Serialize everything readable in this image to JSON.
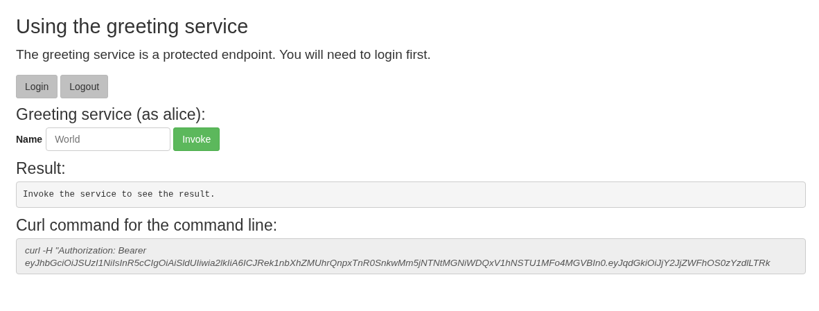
{
  "heading": "Using the greeting service",
  "intro": "The greeting service is a protected endpoint. You will need to login first.",
  "auth_buttons": [
    "Login",
    "Logout"
  ],
  "greeting": {
    "heading": "Greeting service (as alice):",
    "label": "Name",
    "placeholder": "World",
    "button": "Invoke"
  },
  "result": {
    "heading": "Result:",
    "text": "Invoke the service to see the result."
  },
  "curl": {
    "heading": "Curl command for the command line:",
    "lines": [
      "curl -H \"Authorization: Bearer",
      "eyJhbGciOiJSUzI1NiIsInR5cCIgOiAiSldUIiwia2lkIiA6ICJRek1nbXhZMUhrQnpxTnR0SnkwMm5jNTNtMGNiWDQxV1hNSTU1MFo4MGVBIn0.eyJqdGkiOiJjY2JjZWFhOS0zYzdlLTRk"
    ]
  }
}
